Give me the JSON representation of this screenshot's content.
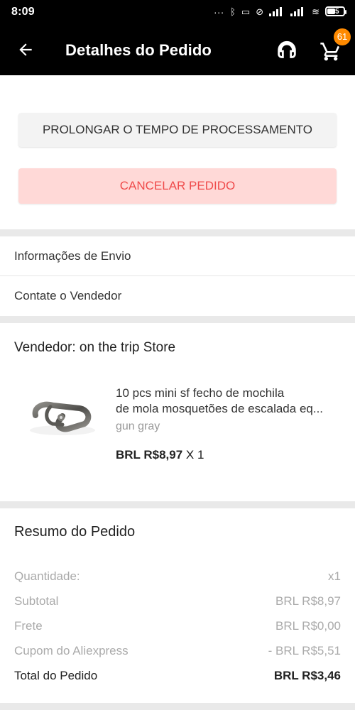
{
  "status_bar": {
    "time": "8:09",
    "dots": "...",
    "battery": "45"
  },
  "header": {
    "title": "Detalhes do Pedido",
    "cart_count": "61"
  },
  "actions": {
    "extend_label": "PROLONGAR O TEMPO DE PROCESSAMENTO",
    "cancel_label": "CANCELAR PEDIDO"
  },
  "links": [
    {
      "label": "Informações de Envio"
    },
    {
      "label": "Contate o Vendedor"
    }
  ],
  "product": {
    "vendor": "Vendedor: on the trip Store",
    "title_line1": "10 pcs mini sf fecho de mochila",
    "title_line2": "de mola mosquetões de escalada eq...",
    "variant": "gun gray",
    "price": "BRL R$8,97",
    "quantity": "X 1"
  },
  "summary": {
    "title": "Resumo do Pedido",
    "rows": [
      {
        "label": "Quantidade:",
        "value": "x1"
      },
      {
        "label": "Subtotal",
        "value": "BRL R$8,97"
      },
      {
        "label": "Frete",
        "value": "BRL R$0,00"
      },
      {
        "label": "Cupom do Aliexpress",
        "value": "- BRL R$5,51"
      }
    ],
    "total": {
      "label": "Total do Pedido",
      "value": "BRL R$3,46"
    }
  },
  "colors": {
    "accent": "#ff8a00",
    "cancel_text": "#ef4b4b",
    "cancel_bg": "#ffd9d7"
  },
  "icons": {
    "back": "arrow-left-icon",
    "support": "headset-icon",
    "cart": "cart-icon"
  }
}
